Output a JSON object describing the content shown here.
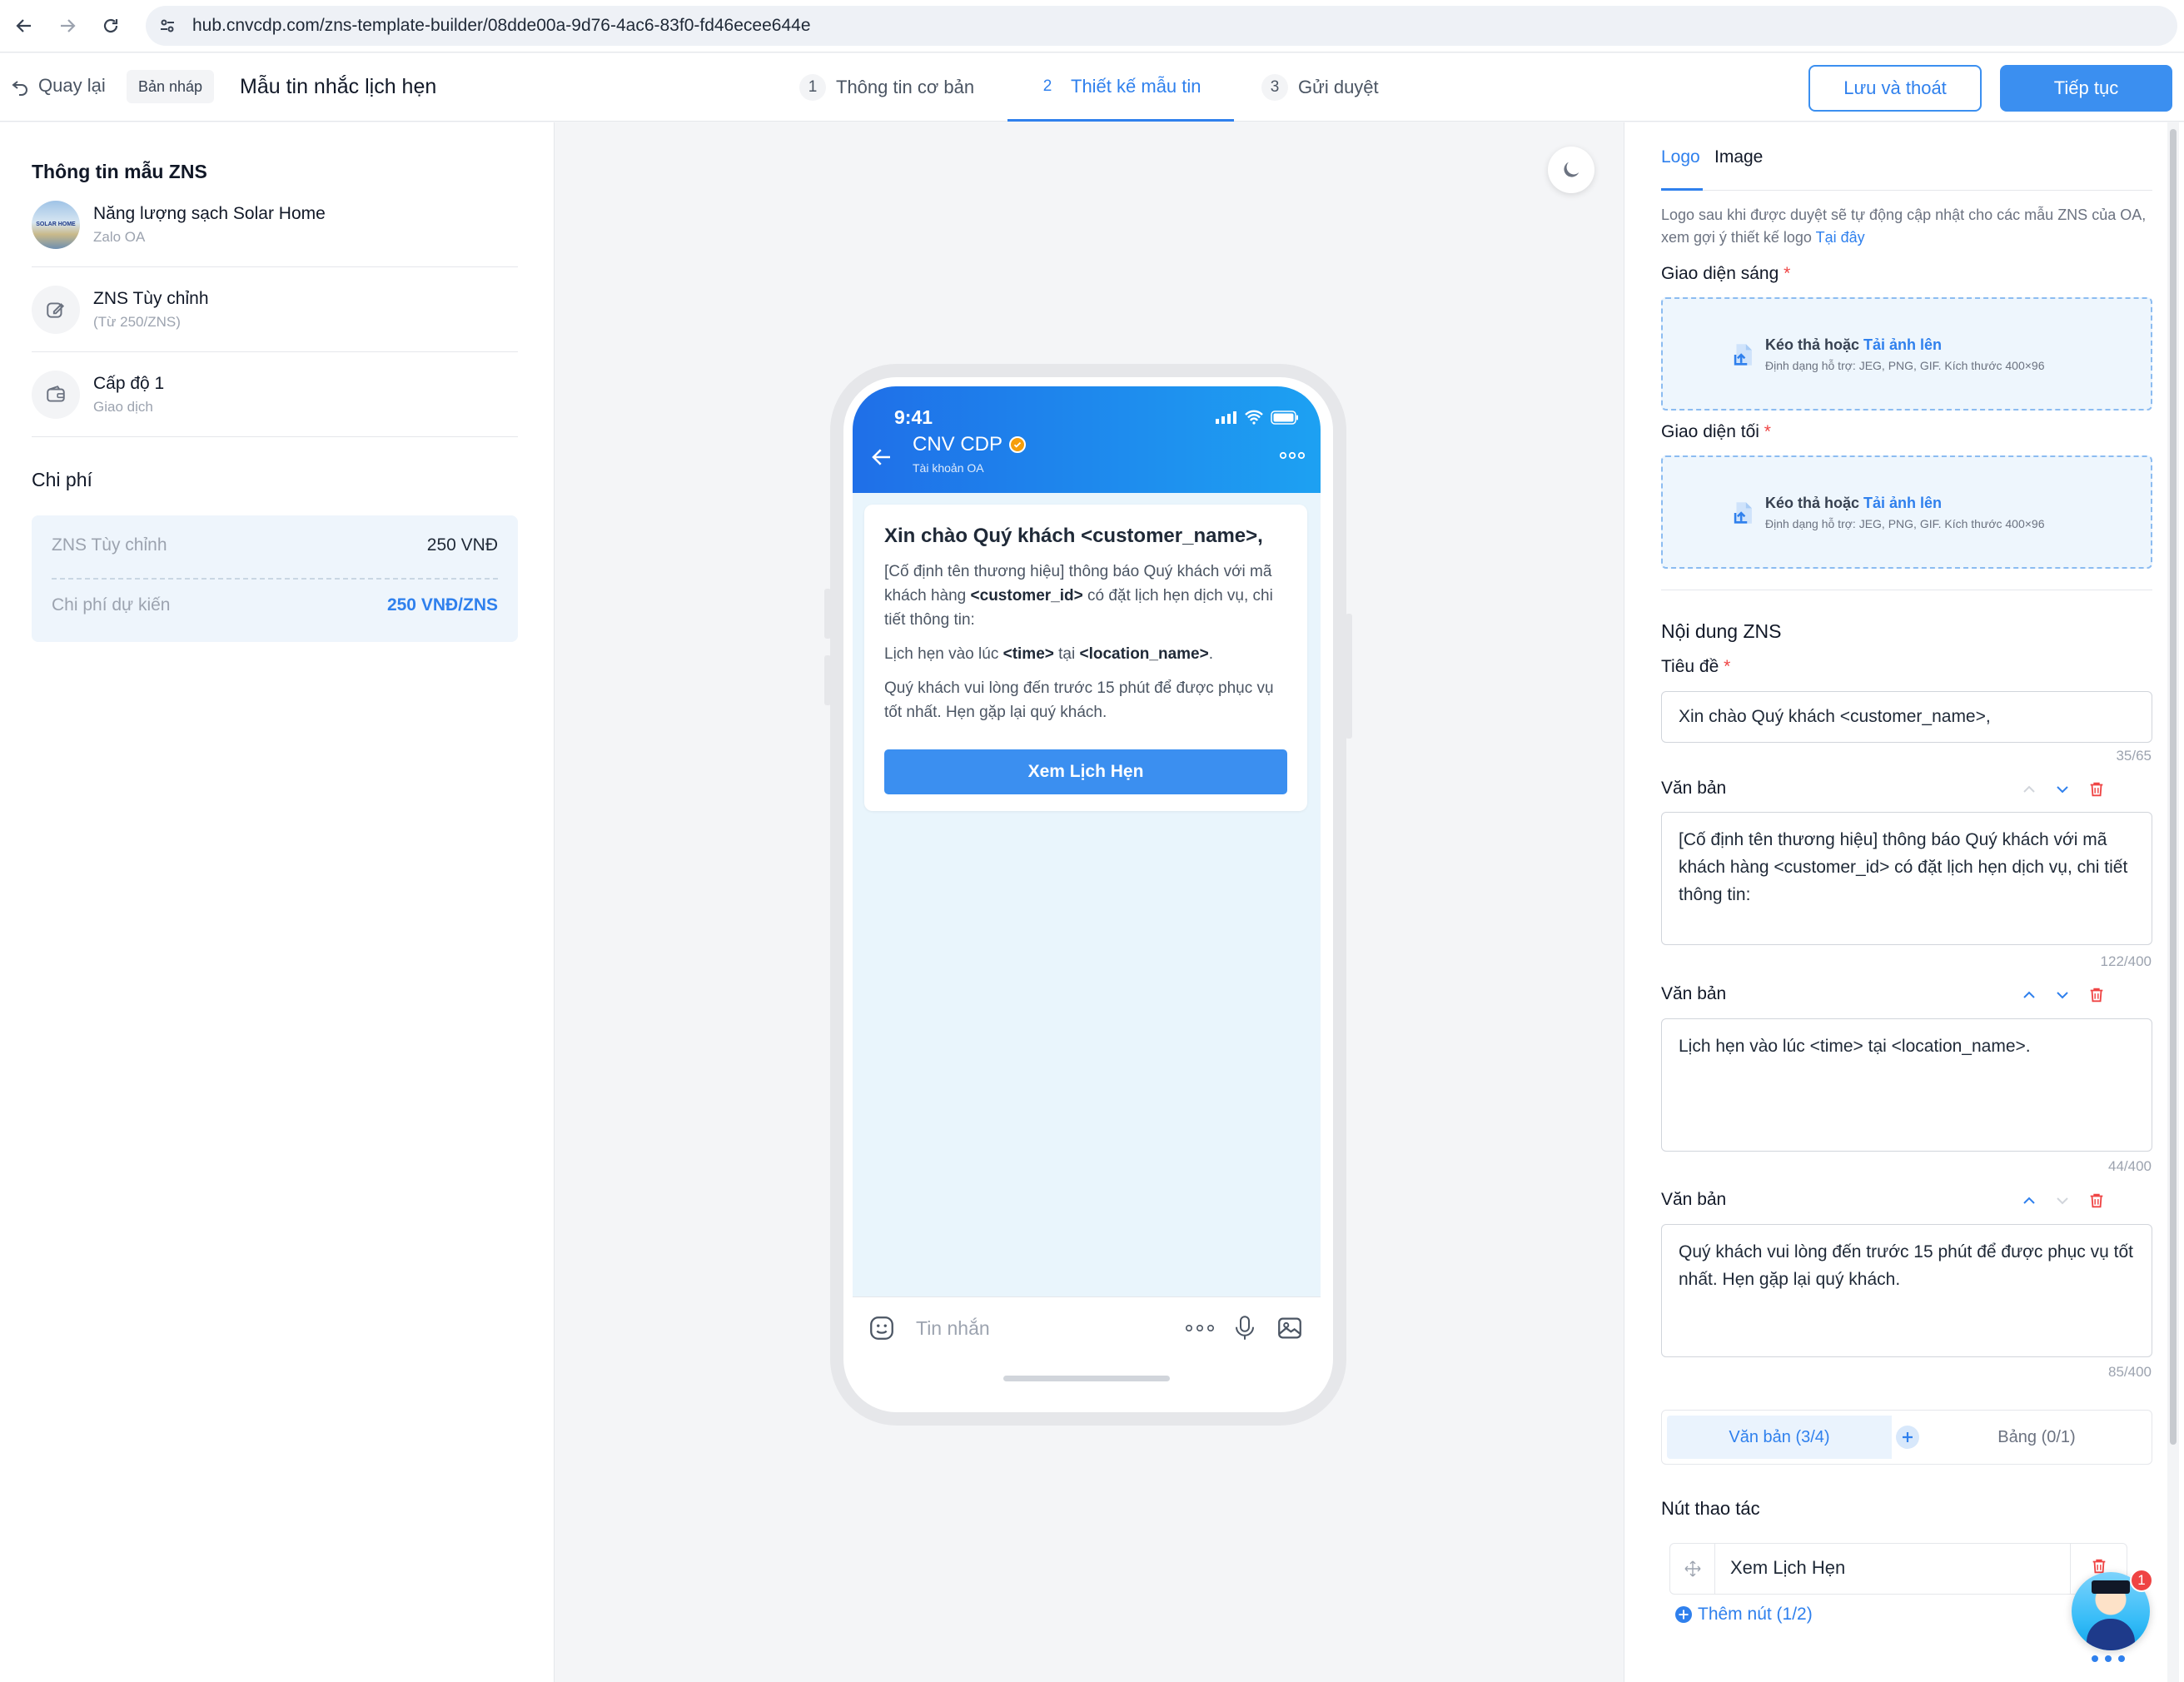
{
  "browser": {
    "url": "hub.cnvcdp.com/zns-template-builder/08dde00a-9d76-4ac6-83f0-fd46ecee644e"
  },
  "header": {
    "back_label": "Quay lại",
    "draft_badge": "Bản nháp",
    "template_name": "Mẫu tin nhắc lịch hẹn",
    "steps": [
      {
        "num": "1",
        "label": "Thông tin cơ bản"
      },
      {
        "num": "2",
        "label": "Thiết kế mẫu tin"
      },
      {
        "num": "3",
        "label": "Gửi duyệt"
      }
    ],
    "active_step": 2,
    "save_exit_label": "Lưu và thoát",
    "continue_label": "Tiếp tục"
  },
  "left": {
    "info_title": "Thông tin mẫu ZNS",
    "items": [
      {
        "title": "Năng lượng sạch Solar Home",
        "subtitle": "Zalo OA",
        "icon": "solar-home-logo"
      },
      {
        "title": "ZNS Tùy chỉnh",
        "subtitle": "(Từ 250/ZNS)",
        "icon": "edit-icon"
      },
      {
        "title": "Cấp độ 1",
        "subtitle": "Giao dịch",
        "icon": "wallet-icon"
      }
    ],
    "cost_title": "Chi phí",
    "cost_rows": [
      {
        "label": "ZNS Tùy chỉnh",
        "value": "250 VNĐ"
      },
      {
        "label": "Chi phí dự kiến",
        "value": "250 VNĐ/ZNS"
      }
    ],
    "logo_text": "SOLAR HOME"
  },
  "phone": {
    "time": "9:41",
    "account_name": "CNV CDP",
    "account_sub": "Tài khoản OA",
    "card": {
      "title": "Xin chào Quý khách <customer_name>,",
      "p1_a": "[Cố định tên thương hiệu] thông báo Quý khách với mã khách hàng ",
      "p1_b": "<customer_id>",
      "p1_c": " có đặt lịch hẹn dịch vụ, chi tiết thông tin:",
      "p2_a": "Lịch hẹn vào lúc ",
      "p2_b": "<time>",
      "p2_c": " tại ",
      "p2_d": "<location_name>",
      "p2_e": ".",
      "p3": "Quý khách vui lòng đến trước 15 phút để được phục vụ tốt nhất. Hẹn gặp lại quý khách.",
      "button": "Xem Lịch Hẹn"
    },
    "input_placeholder": "Tin nhắn"
  },
  "right": {
    "tabs": [
      "Logo",
      "Image"
    ],
    "hint_text": "Logo sau khi được duyệt sẽ tự động cập nhật cho các mẫu ZNS của OA, xem gợi ý thiết kế logo ",
    "hint_link": "Tại đây",
    "light_label": "Giao diện sáng",
    "dark_label": "Giao diện tối",
    "required_mark": "*",
    "upload_text": "Kéo thả hoặc ",
    "upload_link": "Tải ảnh lên",
    "upload_formats": "Định dạng hỗ trợ: JEG, PNG, GIF. Kích thước 400×96",
    "content_title": "Nội dung ZNS",
    "title_label": "Tiêu đề",
    "title_value": "Xin chào Quý khách <customer_name>,",
    "title_counter": "35/65",
    "text_blocks": [
      {
        "label": "Văn bản",
        "value": "[Cố định tên thương hiệu] thông báo Quý khách với mã khách hàng <customer_id> có đặt lịch hẹn dịch vụ, chi tiết thông tin:",
        "counter": "122/400"
      },
      {
        "label": "Văn bản",
        "value": "Lịch hẹn vào lúc <time> tại <location_name>.",
        "counter": "44/400"
      },
      {
        "label": "Văn bản",
        "value": "Quý khách vui lòng đến trước 15 phút để được phục vụ tốt nhất. Hẹn gặp lại quý khách.",
        "counter": "85/400"
      }
    ],
    "toggle_text": "Văn bản (3/4)",
    "toggle_table": "Bảng (0/1)",
    "action_title": "Nút thao tác",
    "action_button_value": "Xem Lịch Hẹn",
    "add_button_label": "Thêm nút (1/2)",
    "notification_count": "1"
  }
}
